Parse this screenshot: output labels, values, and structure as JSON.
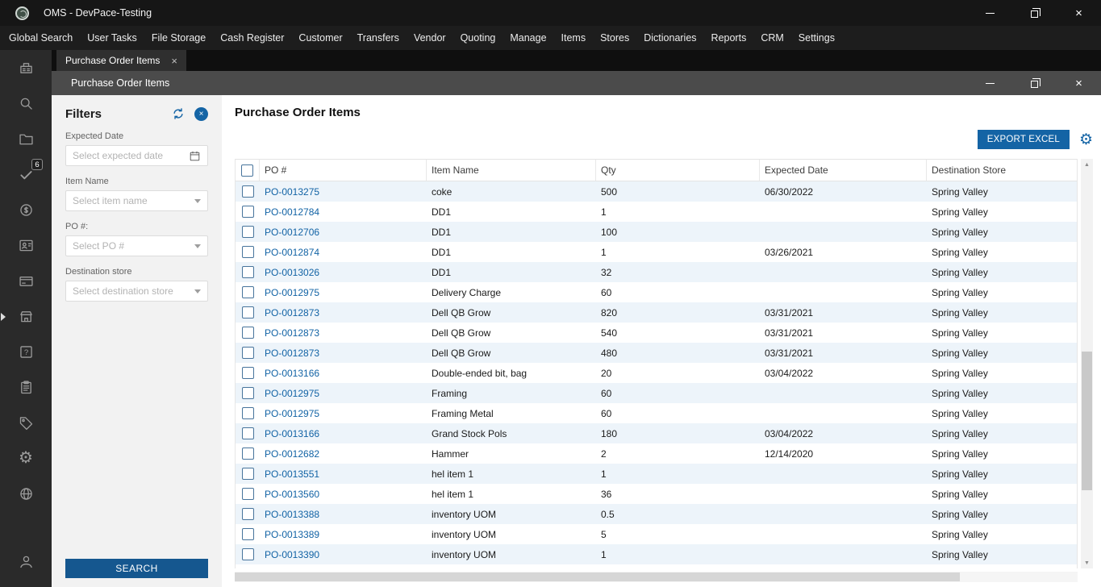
{
  "window": {
    "title": "OMS - DevPace-Testing"
  },
  "menu": {
    "items": [
      "Global Search",
      "User Tasks",
      "File Storage",
      "Cash Register",
      "Customer",
      "Transfers",
      "Vendor",
      "Quoting",
      "Manage",
      "Items",
      "Stores",
      "Dictionaries",
      "Reports",
      "CRM",
      "Settings"
    ]
  },
  "tab": {
    "label": "Purchase Order Items"
  },
  "inner_window": {
    "title": "Purchase Order Items"
  },
  "sidebar": {
    "badge_count": "6",
    "icons": [
      "cash-register",
      "search",
      "folder",
      "tasks-check",
      "money",
      "contact-card",
      "card",
      "store",
      "help",
      "clipboard",
      "tag",
      "gear",
      "globe",
      "user"
    ]
  },
  "filters": {
    "title": "Filters",
    "expected_date": {
      "label": "Expected Date",
      "placeholder": "Select expected date"
    },
    "item_name": {
      "label": "Item Name",
      "placeholder": "Select item name"
    },
    "po_number": {
      "label": "PO #:",
      "placeholder": "Select PO #"
    },
    "destination_store": {
      "label": "Destination store",
      "placeholder": "Select destination store"
    },
    "search_label": "SEARCH"
  },
  "main": {
    "title": "Purchase Order Items",
    "export_label": "EXPORT EXCEL"
  },
  "table": {
    "columns": [
      "PO #",
      "Item Name",
      "Qty",
      "Expected Date",
      "Destination Store"
    ],
    "rows": [
      {
        "po": "PO-0013275",
        "item": "coke",
        "qty": "500",
        "date": "06/30/2022",
        "store": "Spring Valley"
      },
      {
        "po": "PO-0012784",
        "item": "DD1",
        "qty": "1",
        "date": "",
        "store": "Spring Valley"
      },
      {
        "po": "PO-0012706",
        "item": "DD1",
        "qty": "100",
        "date": "",
        "store": "Spring Valley"
      },
      {
        "po": "PO-0012874",
        "item": "DD1",
        "qty": "1",
        "date": "03/26/2021",
        "store": "Spring Valley"
      },
      {
        "po": "PO-0013026",
        "item": "DD1",
        "qty": "32",
        "date": "",
        "store": "Spring Valley"
      },
      {
        "po": "PO-0012975",
        "item": "Delivery Charge",
        "qty": "60",
        "date": "",
        "store": "Spring Valley"
      },
      {
        "po": "PO-0012873",
        "item": "Dell QB Grow",
        "qty": "820",
        "date": "03/31/2021",
        "store": "Spring Valley"
      },
      {
        "po": "PO-0012873",
        "item": "Dell QB Grow",
        "qty": "540",
        "date": "03/31/2021",
        "store": "Spring Valley"
      },
      {
        "po": "PO-0012873",
        "item": "Dell QB Grow",
        "qty": "480",
        "date": "03/31/2021",
        "store": "Spring Valley"
      },
      {
        "po": "PO-0013166",
        "item": "Double-ended bit, bag",
        "qty": "20",
        "date": "03/04/2022",
        "store": "Spring Valley"
      },
      {
        "po": "PO-0012975",
        "item": "Framing",
        "qty": "60",
        "date": "",
        "store": "Spring Valley"
      },
      {
        "po": "PO-0012975",
        "item": "Framing Metal",
        "qty": "60",
        "date": "",
        "store": "Spring Valley"
      },
      {
        "po": "PO-0013166",
        "item": "Grand Stock Pols",
        "qty": "180",
        "date": "03/04/2022",
        "store": "Spring Valley"
      },
      {
        "po": "PO-0012682",
        "item": "Hammer",
        "qty": "2",
        "date": "12/14/2020",
        "store": "Spring Valley"
      },
      {
        "po": "PO-0013551",
        "item": "hel item 1",
        "qty": "1",
        "date": "",
        "store": "Spring Valley"
      },
      {
        "po": "PO-0013560",
        "item": "hel item 1",
        "qty": "36",
        "date": "",
        "store": "Spring Valley"
      },
      {
        "po": "PO-0013388",
        "item": "inventory UOM",
        "qty": "0.5",
        "date": "",
        "store": "Spring Valley"
      },
      {
        "po": "PO-0013389",
        "item": "inventory UOM",
        "qty": "5",
        "date": "",
        "store": "Spring Valley"
      },
      {
        "po": "PO-0013390",
        "item": "inventory UOM",
        "qty": "1",
        "date": "",
        "store": "Spring Valley"
      }
    ]
  },
  "icons": {
    "gear": "⚙",
    "close": "×",
    "scroll_up": "▲",
    "scroll_down": "▼"
  },
  "colors": {
    "accent_blue": "#1464a5",
    "search_blue": "#15578f",
    "link_blue": "#1263a5",
    "row_alt": "#edf4fa"
  }
}
